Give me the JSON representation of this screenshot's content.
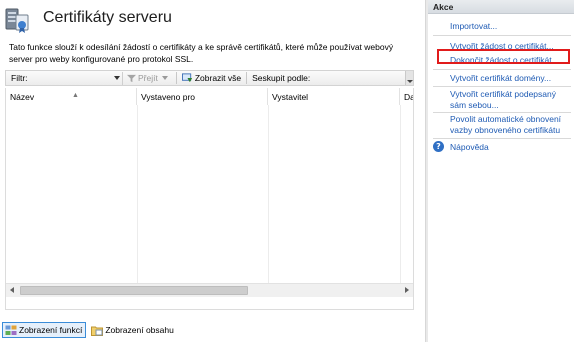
{
  "header": {
    "title": "Certifikáty serveru",
    "description": "Tato funkce slouží k odesílání žádostí o certifikáty a ke správě certifikátů, které může používat webový server pro weby konfigurované pro protokol SSL."
  },
  "toolbar": {
    "filter_label": "Filtr:",
    "filter_value": "",
    "go_label": "Přejít",
    "show_all_label": "Zobrazit vše",
    "group_by_label": "Seskupit podle:"
  },
  "grid": {
    "columns": [
      "Název",
      "Vystaveno pro",
      "Vystavitel",
      "Da"
    ],
    "rows": []
  },
  "views": {
    "features": "Zobrazení funkcí",
    "content": "Zobrazení obsahu"
  },
  "actions": {
    "title": "Akce",
    "items": [
      "Importovat...",
      "Vytvořit žádost o certifikát...",
      "Dokončit žádost o certifikát...",
      "Vytvořit certifikát domény...",
      "Vytvořit certifikát podepsaný sám sebou...",
      "Povolit automatické obnovení vazby obnoveného certifikátu",
      "Nápověda"
    ]
  },
  "colors": {
    "link": "#1f5bb4",
    "highlight": "#e11b1b",
    "active_tab": "#3a8cd8"
  }
}
